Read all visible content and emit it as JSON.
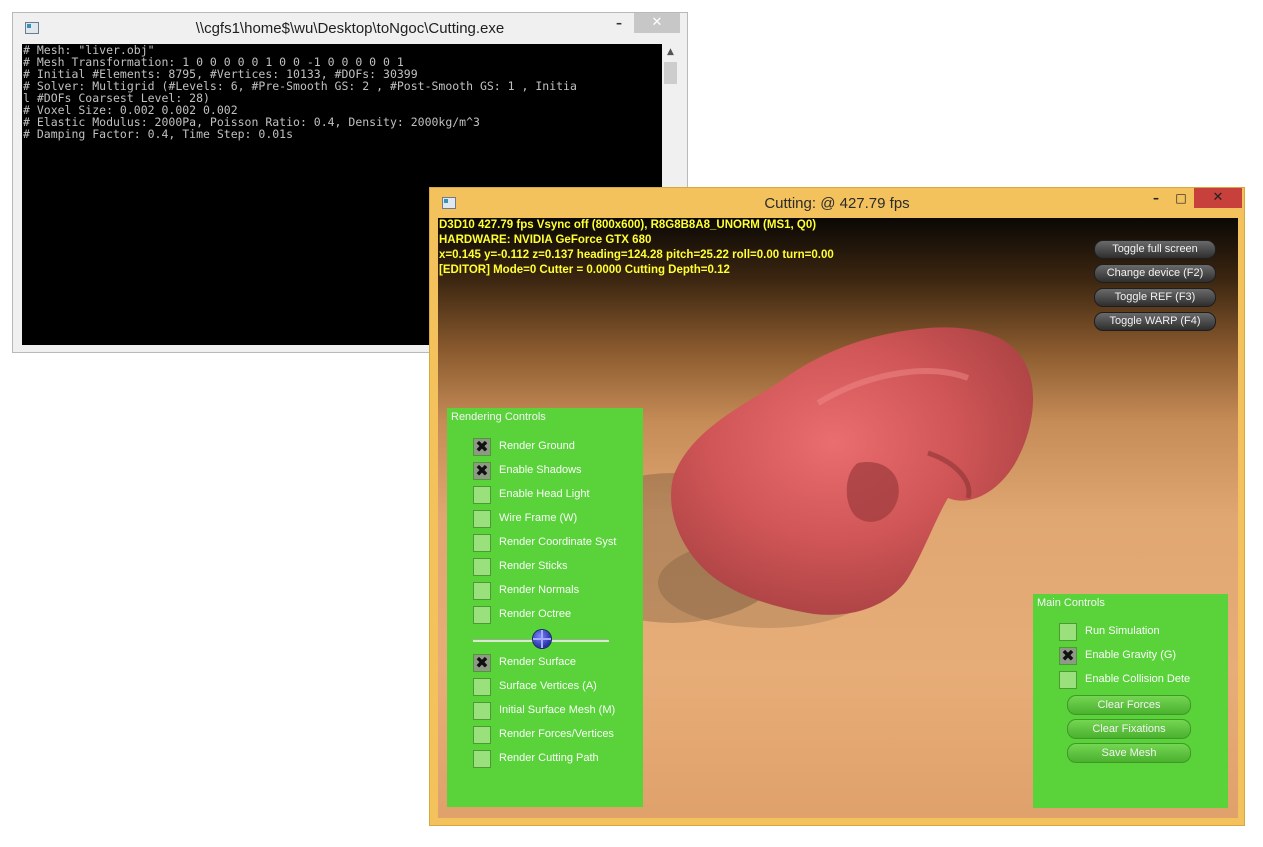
{
  "console": {
    "title": "\\\\cgfs1\\home$\\wu\\Desktop\\toNgoc\\Cutting.exe",
    "lines": [
      "# Mesh: \"liver.obj\"",
      "# Mesh Transformation: 1 0 0 0 0 0 1 0 0 -1 0 0 0 0 0 1",
      "# Initial #Elements: 8795, #Vertices: 10133, #DOFs: 30399",
      "# Solver: Multigrid (#Levels: 6, #Pre-Smooth GS: 2 , #Post-Smooth GS: 1 , Initia",
      "l #DOFs Coarsest Level: 28)",
      "# Voxel Size: 0.002 0.002 0.002",
      "# Elastic Modulus: 2000Pa, Poisson Ratio: 0.4, Density: 2000kg/m^3",
      "# Damping Factor: 0.4, Time Step: 0.01s"
    ]
  },
  "cutting": {
    "title": "Cutting: @ 427.79 fps",
    "hud": [
      "D3D10 427.79 fps Vsync off (800x600), R8G8B8A8_UNORM (MS1, Q0)",
      "HARDWARE: NVIDIA GeForce GTX 680",
      "x=0.145 y=-0.112 z=0.137 heading=124.28 pitch=25.22 roll=0.00 turn=0.00",
      "[EDITOR] Mode=0 Cutter = 0.0000 Cutting Depth=0.12"
    ],
    "device_buttons": [
      "Toggle full screen",
      "Change device (F2)",
      "Toggle REF (F3)",
      "Toggle WARP (F4)"
    ],
    "rendering_controls": {
      "title": "Rendering Controls",
      "items": [
        {
          "label": "Render Ground",
          "checked": true
        },
        {
          "label": "Enable Shadows",
          "checked": true
        },
        {
          "label": "Enable Head Light",
          "checked": false
        },
        {
          "label": "Wire Frame (W)",
          "checked": false
        },
        {
          "label": "Render Coordinate Syst",
          "checked": false
        },
        {
          "label": "Render Sticks",
          "checked": false
        },
        {
          "label": "Render Normals",
          "checked": false
        },
        {
          "label": "Render Octree",
          "checked": false
        }
      ],
      "items2": [
        {
          "label": "Render Surface",
          "checked": true
        },
        {
          "label": "Surface Vertices (A)",
          "checked": false
        },
        {
          "label": "Initial Surface Mesh (M)",
          "checked": false
        },
        {
          "label": "Render Forces/Vertices",
          "checked": false
        },
        {
          "label": "Render Cutting Path",
          "checked": false
        }
      ]
    },
    "main_controls": {
      "title": "Main Controls",
      "items": [
        {
          "label": "Run Simulation",
          "checked": false
        },
        {
          "label": "Enable Gravity (G)",
          "checked": true
        },
        {
          "label": "Enable Collision Dete",
          "checked": false
        }
      ],
      "buttons": [
        "Clear Forces",
        "Clear Fixations",
        "Save Mesh"
      ]
    }
  },
  "icons": {
    "minimize": "minimize-icon",
    "maximize": "maximize-icon",
    "close": "close-icon",
    "app": "app-icon"
  }
}
